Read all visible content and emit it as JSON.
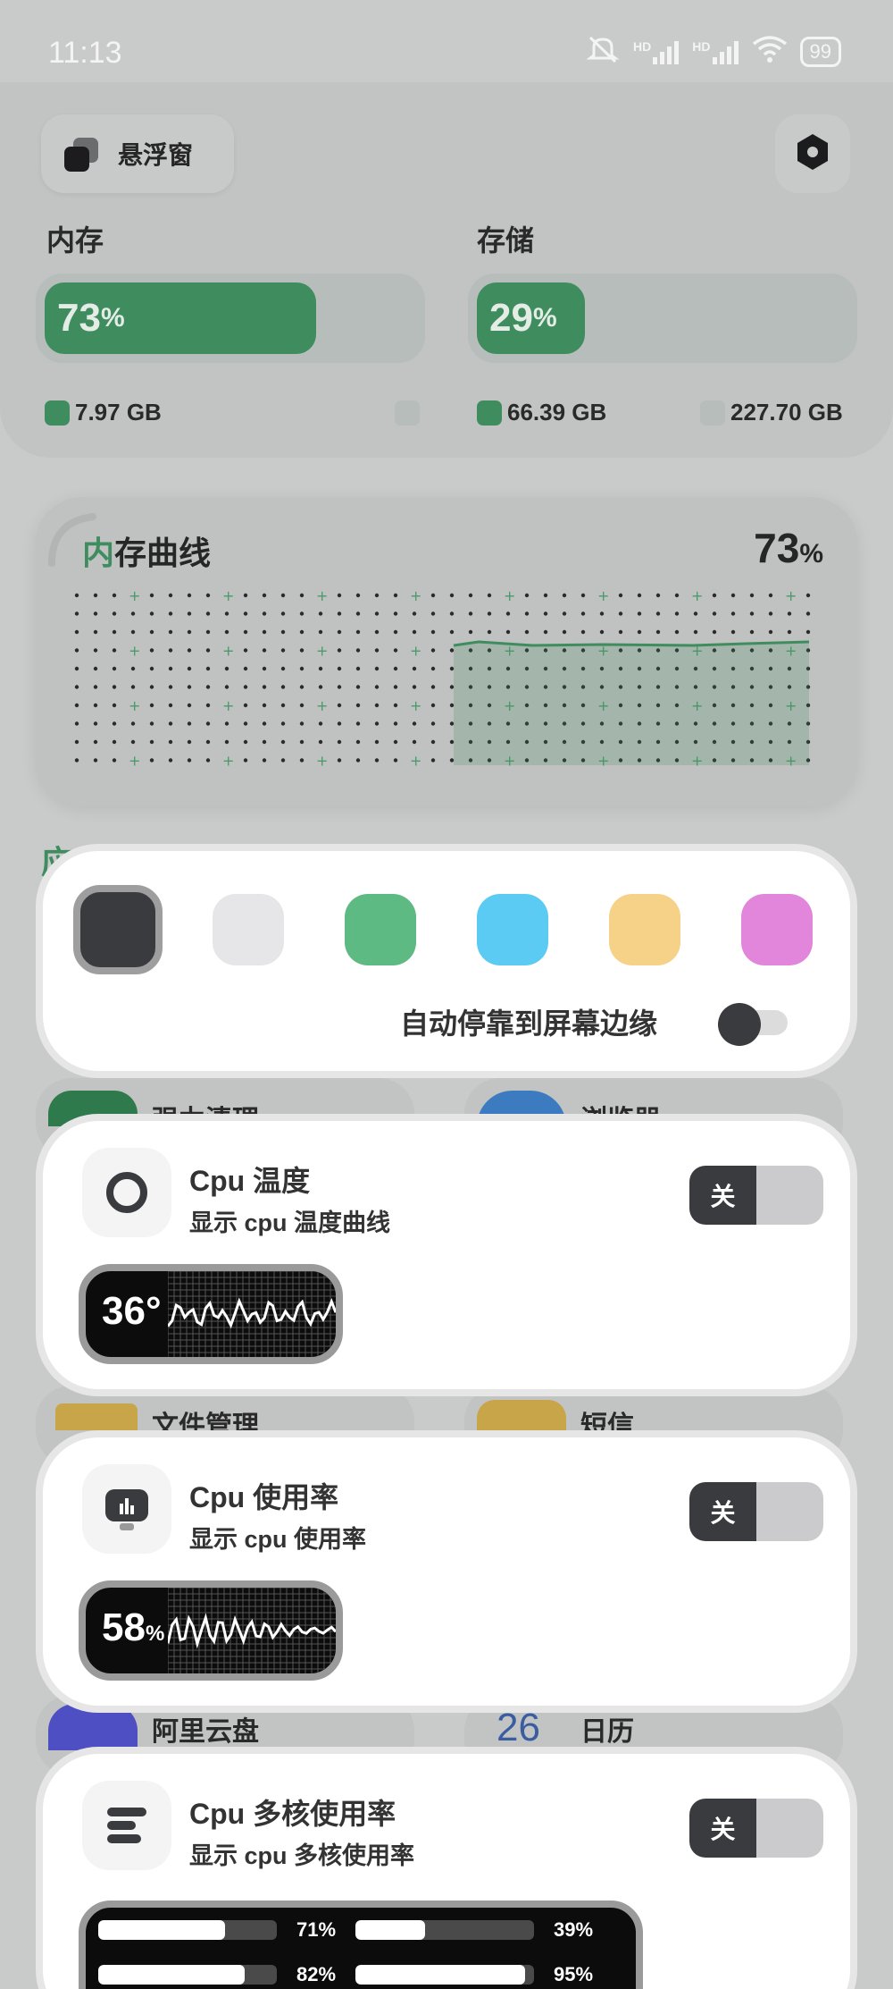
{
  "status_bar": {
    "time": "11:13",
    "signal1": "HD",
    "signal2": "HD",
    "battery": "99"
  },
  "header": {
    "float_window_label": "悬浮窗"
  },
  "memory": {
    "title": "内存",
    "percent": "73",
    "unit": "%",
    "used": "7.97 GB",
    "fraction": 0.73
  },
  "storage": {
    "title": "存储",
    "percent": "29",
    "unit": "%",
    "used": "66.39 GB",
    "total": "227.70 GB",
    "fraction": 0.29
  },
  "memory_curve": {
    "title_accent": "内",
    "title_rest": "存曲线",
    "value": "73",
    "unit": "%"
  },
  "section_label": "应",
  "color_panel": {
    "colors": [
      "#3a3b3e",
      "#e6e6e8",
      "#5dba82",
      "#5ccbf3",
      "#f6d288",
      "#e186db"
    ],
    "selected_index": 0,
    "dock_label": "自动停靠到屏幕边缘"
  },
  "apps": {
    "clean": "强力清理",
    "browser": "浏览器",
    "files": "文件管理",
    "sms": "短信",
    "aliyun": "阿里云盘",
    "calendar": "日历",
    "calendar_day": "26"
  },
  "widgets": {
    "cpu_temp": {
      "title": "Cpu 温度",
      "subtitle": "显示 cpu 温度曲线",
      "toggle": "关",
      "preview_value": "36°"
    },
    "cpu_usage": {
      "title": "Cpu 使用率",
      "subtitle": "显示 cpu 使用率",
      "toggle": "关",
      "preview_value": "58",
      "preview_unit": "%"
    },
    "cpu_multi": {
      "title": "Cpu 多核使用率",
      "subtitle": "显示 cpu 多核使用率",
      "toggle": "关",
      "cores": [
        {
          "label": "71%",
          "value": 0.71
        },
        {
          "label": "39%",
          "value": 0.39
        },
        {
          "label": "82%",
          "value": 0.82
        },
        {
          "label": "95%",
          "value": 0.95
        }
      ]
    }
  }
}
